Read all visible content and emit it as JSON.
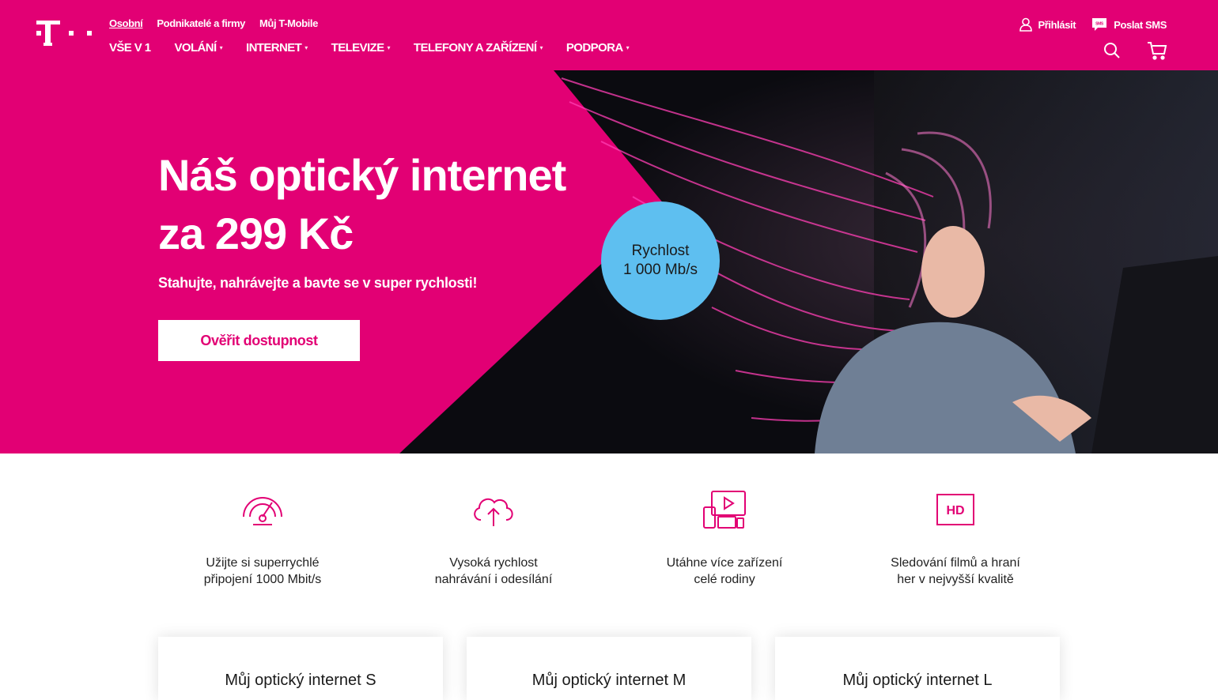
{
  "header": {
    "top_links": [
      "Osobní",
      "Podnikatelé a firmy",
      "Můj T-Mobile"
    ],
    "main_nav": [
      {
        "label": "VŠE V 1",
        "has_caret": false
      },
      {
        "label": "VOLÁNÍ",
        "has_caret": true
      },
      {
        "label": "INTERNET",
        "has_caret": true
      },
      {
        "label": "TELEVIZE",
        "has_caret": true
      },
      {
        "label": "TELEFONY A ZAŘÍZENÍ",
        "has_caret": true
      },
      {
        "label": "PODPORA",
        "has_caret": true
      }
    ],
    "login_label": "Přihlásit",
    "sms_label": "Poslat SMS",
    "sms_icon_text": "SMS"
  },
  "hero": {
    "title_line1": "Náš optický internet",
    "title_line2": "za 299 Kč",
    "subtitle": "Stahujte, nahrávejte a bavte se v super rychlosti!",
    "button_label": "Ověřit dostupnost",
    "badge_line1": "Rychlost",
    "badge_line2": "1 000 Mb/s"
  },
  "features": [
    {
      "icon": "speedometer-icon",
      "line1": "Užijte si superrychlé",
      "line2": "připojení 1000 Mbit/s"
    },
    {
      "icon": "cloud-upload-icon",
      "line1": "Vysoká rychlost",
      "line2": "nahrávání i odesílání"
    },
    {
      "icon": "devices-icon",
      "line1": "Utáhne více zařízení",
      "line2": "celé rodiny"
    },
    {
      "icon": "hd-icon",
      "line1": "Sledování filmů a hraní",
      "line2": "her v nejvyšší kvalitě",
      "icon_text": "HD"
    }
  ],
  "cards": [
    {
      "title": "Můj optický internet S"
    },
    {
      "title": "Můj optický internet M"
    },
    {
      "title": "Můj optický internet L"
    }
  ],
  "colors": {
    "magenta": "#e20074",
    "badge_blue": "#5ebff0"
  }
}
